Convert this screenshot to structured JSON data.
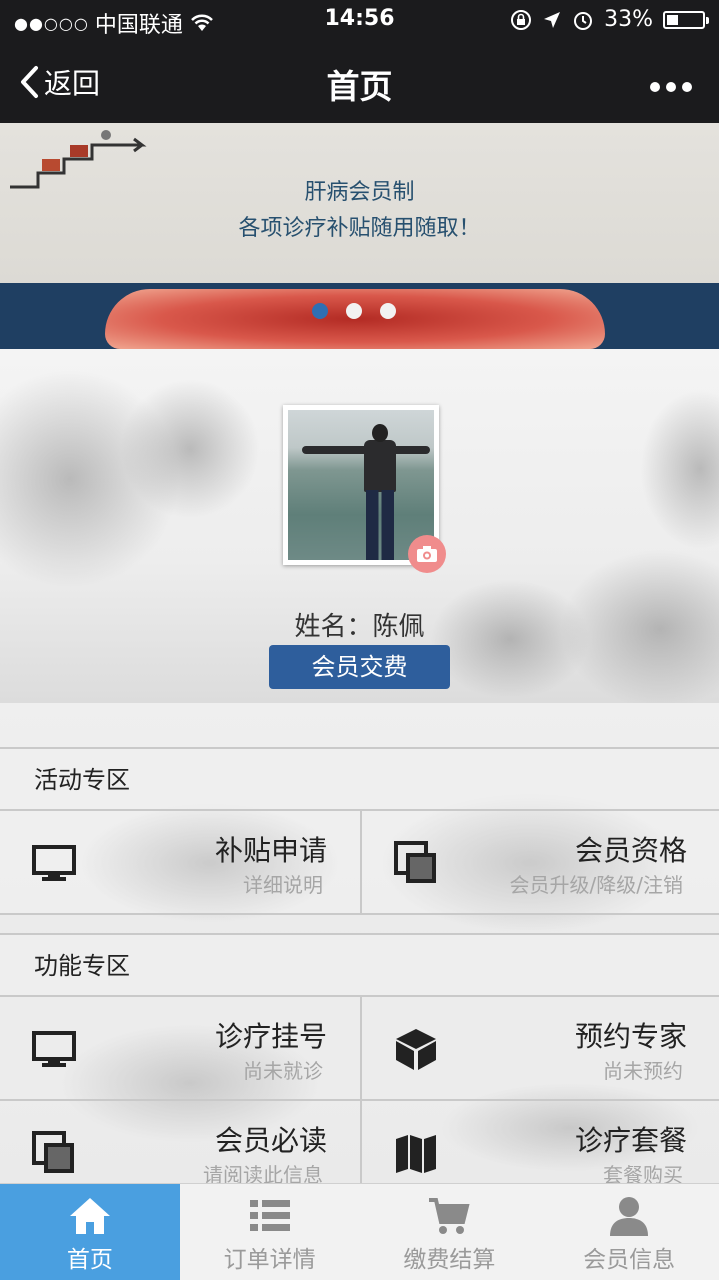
{
  "status_bar": {
    "carrier": "中国联通",
    "signal_dots": "●●○○○",
    "time": "14:56",
    "battery_percent": "33%",
    "battery_level": 0.33
  },
  "nav": {
    "back_label": "返回",
    "title": "首页",
    "more_label": "•••"
  },
  "banner": {
    "line1": "肝病会员制",
    "line2": "各项诊疗补贴随用随取！",
    "slide_count": 3,
    "active_slide": 1
  },
  "profile": {
    "name_label": "姓名：",
    "name_value": "陈佩",
    "pay_button": "会员交费"
  },
  "sections": [
    {
      "title": "活动专区",
      "items": [
        {
          "icon": "monitor-icon",
          "title": "补贴申请",
          "subtitle": "详细说明"
        },
        {
          "icon": "copy-icon",
          "title": "会员资格",
          "subtitle": "会员升级/降级/注销"
        }
      ]
    },
    {
      "title": "功能专区",
      "items": [
        {
          "icon": "monitor-icon",
          "title": "诊疗挂号",
          "subtitle": "尚未就诊"
        },
        {
          "icon": "cube-icon",
          "title": "预约专家",
          "subtitle": "尚未预约"
        },
        {
          "icon": "copy-icon",
          "title": "会员必读",
          "subtitle": "请阅读此信息"
        },
        {
          "icon": "map-icon",
          "title": "诊疗套餐",
          "subtitle": "套餐购买"
        }
      ]
    }
  ],
  "tabbar": [
    {
      "label": "首页",
      "icon": "home-icon",
      "active": true
    },
    {
      "label": "订单详情",
      "icon": "list-icon",
      "active": false
    },
    {
      "label": "缴费结算",
      "icon": "cart-icon",
      "active": false
    },
    {
      "label": "会员信息",
      "icon": "user-icon",
      "active": false
    }
  ],
  "colors": {
    "nav_bg": "#1b1b1d",
    "pay_button": "#2e5e9c",
    "tab_active": "#4a9fe0",
    "banner_text": "#27506f"
  }
}
